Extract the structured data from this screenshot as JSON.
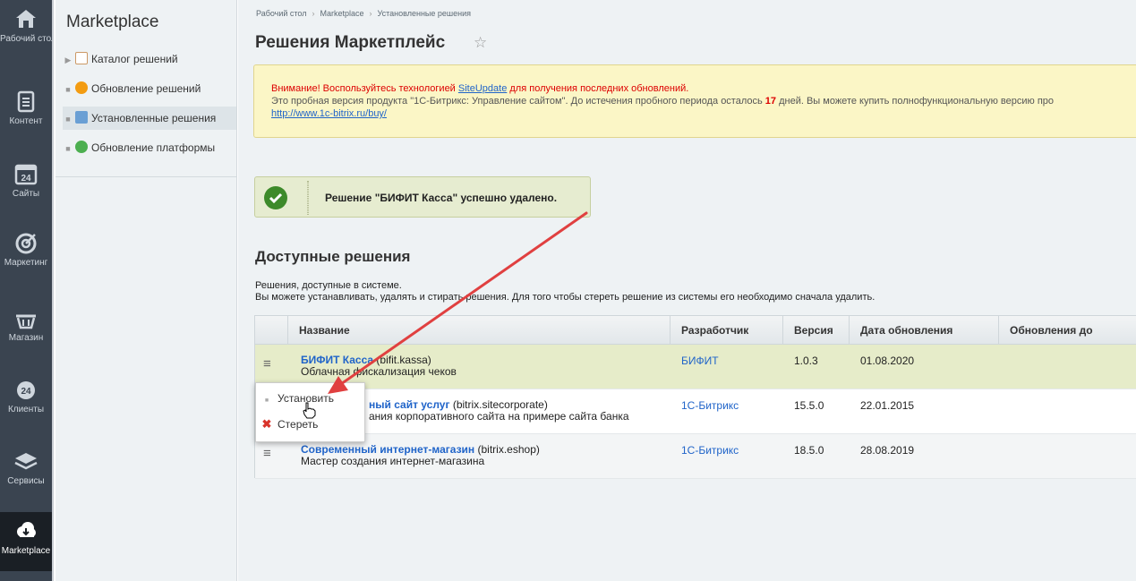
{
  "rail": [
    {
      "label": "Рабочий стол",
      "icon": "home-icon"
    },
    {
      "label": "Контент",
      "icon": "document-icon"
    },
    {
      "label": "Сайты",
      "icon": "calendar-icon"
    },
    {
      "label": "Маркетинг",
      "icon": "target-icon"
    },
    {
      "label": "Магазин",
      "icon": "basket-icon"
    },
    {
      "label": "Клиенты",
      "icon": "clients-icon"
    },
    {
      "label": "Сервисы",
      "icon": "layers-icon"
    },
    {
      "label": "Marketplace",
      "icon": "cloud-download-icon"
    }
  ],
  "sidebar": {
    "title": "Marketplace",
    "items": [
      {
        "label": "Каталог решений",
        "icon": "catalog-icon"
      },
      {
        "label": "Обновление решений",
        "icon": "update-icon"
      },
      {
        "label": "Установленные решения",
        "icon": "installed-icon"
      },
      {
        "label": "Обновление платформы",
        "icon": "platform-update-icon"
      }
    ]
  },
  "breadcrumb": [
    "Рабочий стол",
    "Marketplace",
    "Установленные решения"
  ],
  "page_title": "Решения Маркетплейс",
  "notice": {
    "warn_prefix": "Внимание! Воспользуйтесь технологией ",
    "warn_link": "SiteUpdate",
    "warn_suffix": " для получения последних обновлений.",
    "body_prefix": "Это пробная версия продукта \"1С-Битрикс: Управление сайтом\". До истечения пробного периода осталось ",
    "days": "17",
    "body_suffix": " дней. Вы можете купить полнофункциональную версию про",
    "buy_link": "http://www.1c-bitrix.ru/buy/"
  },
  "success": {
    "message": "Решение \"БИФИТ Касса\" успешно удалено."
  },
  "section": {
    "title": "Доступные решения",
    "desc_line1": "Решения, доступные в системе.",
    "desc_line2": "Вы можете устанавливать, удалять и стирать решения. Для того чтобы стереть решение из системы его необходимо сначала удалить."
  },
  "grid": {
    "columns": [
      "Название",
      "Разработчик",
      "Версия",
      "Дата обновления",
      "Обновления до"
    ],
    "rows": [
      {
        "name": "БИФИТ Касса",
        "code": " (bifit.kassa)",
        "desc": "Облачная фискализация чеков",
        "developer": "БИФИТ",
        "version": "1.0.3",
        "date": "01.08.2020"
      },
      {
        "name": "ный сайт услуг",
        "code": " (bitrix.sitecorporate)",
        "desc": "ания корпоративного сайта на примере сайта банка",
        "developer": "1С-Битрикс",
        "version": "15.5.0",
        "date": "22.01.2015"
      },
      {
        "name": "Современный интернет-магазин",
        "code": " (bitrix.eshop)",
        "desc": "Мастер создания интернет-магазина",
        "developer": "1С-Битрикс",
        "version": "18.5.0",
        "date": "28.08.2019"
      }
    ]
  },
  "popup": {
    "items": [
      {
        "label": "Установить",
        "icon": "bullet-icon"
      },
      {
        "label": "Стереть",
        "icon": "delete-x-icon"
      }
    ]
  },
  "colors": {
    "accent_link": "#2064c9",
    "annotation_arrow": "#e04040",
    "success_green": "#3d8a2a"
  }
}
